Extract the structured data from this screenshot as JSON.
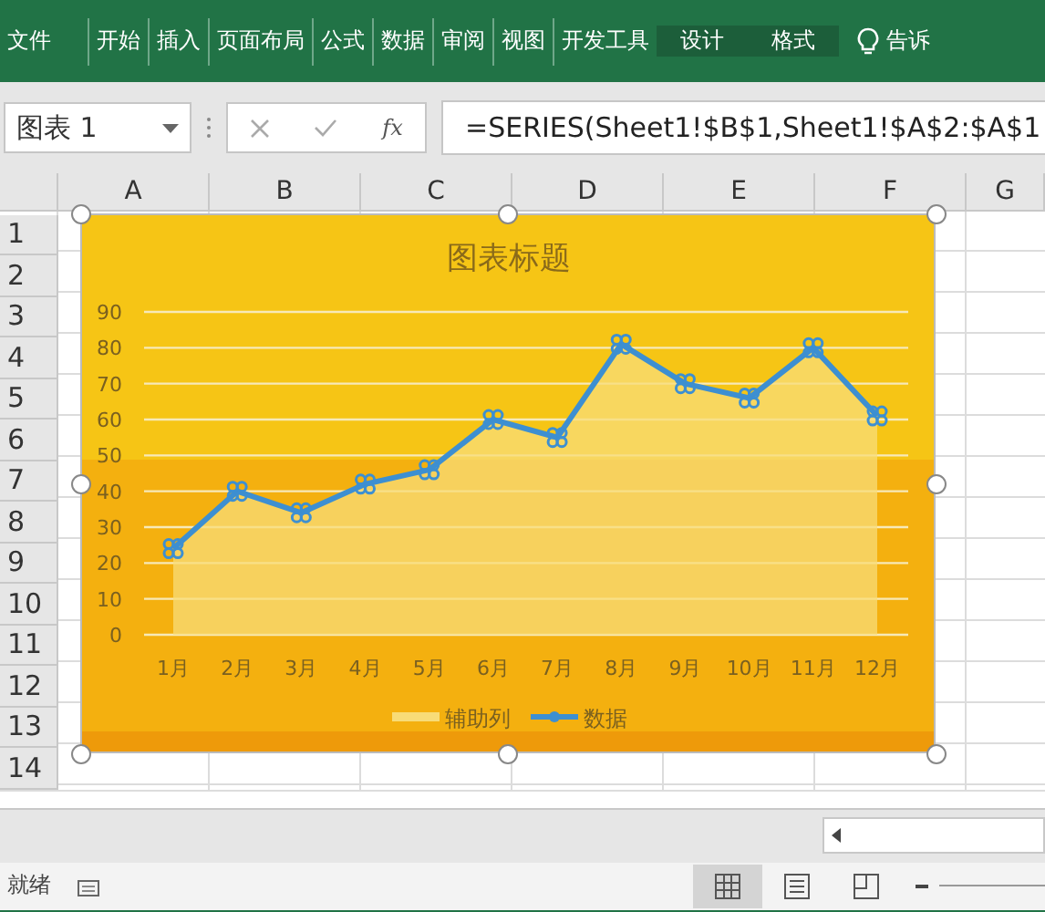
{
  "ribbon": {
    "tabs": [
      {
        "label": "文件",
        "kind": "file"
      },
      {
        "label": "开始",
        "kind": "normal"
      },
      {
        "label": "插入",
        "kind": "normal"
      },
      {
        "label": "页面布局",
        "kind": "normal"
      },
      {
        "label": "公式",
        "kind": "normal"
      },
      {
        "label": "数据",
        "kind": "normal"
      },
      {
        "label": "审阅",
        "kind": "normal"
      },
      {
        "label": "视图",
        "kind": "normal"
      },
      {
        "label": "开发工具",
        "kind": "normal"
      },
      {
        "label": "设计",
        "kind": "contextual"
      },
      {
        "label": "格式",
        "kind": "contextual"
      }
    ],
    "tell_me": "告诉"
  },
  "formula_bar": {
    "name_box": "图表 1",
    "fx": "fx",
    "formula": "=SERIES(Sheet1!$B$1,Sheet1!$A$2:$A$1"
  },
  "sheet": {
    "columns": [
      "A",
      "B",
      "C",
      "D",
      "E",
      "F",
      "G"
    ],
    "rows": [
      "1",
      "2",
      "3",
      "4",
      "5",
      "6",
      "7",
      "8",
      "9",
      "10",
      "11",
      "12",
      "13",
      "14"
    ]
  },
  "chart": {
    "title": "图表标题",
    "chart_data": {
      "type": "line",
      "categories": [
        "1月",
        "2月",
        "3月",
        "4月",
        "5月",
        "6月",
        "7月",
        "8月",
        "9月",
        "10月",
        "11月",
        "12月"
      ],
      "yticks": [
        0,
        10,
        20,
        30,
        40,
        50,
        60,
        70,
        80,
        90
      ],
      "ylim": [
        0,
        90
      ],
      "grid": true,
      "legend": true,
      "series": [
        {
          "name": "辅助列",
          "type": "area",
          "color": "#f8dc78",
          "values": [
            24,
            40,
            34,
            42,
            46,
            60,
            55,
            81,
            70,
            66,
            80,
            61
          ]
        },
        {
          "name": "数据",
          "type": "line",
          "color": "#3d8fd1",
          "values": [
            24,
            40,
            34,
            42,
            46,
            60,
            55,
            81,
            70,
            66,
            80,
            61
          ]
        }
      ]
    }
  },
  "status_bar": {
    "status": "就绪",
    "views": [
      {
        "kind": "normal",
        "selected": true
      },
      {
        "kind": "page-layout",
        "selected": false
      },
      {
        "kind": "page-break",
        "selected": false
      }
    ]
  }
}
